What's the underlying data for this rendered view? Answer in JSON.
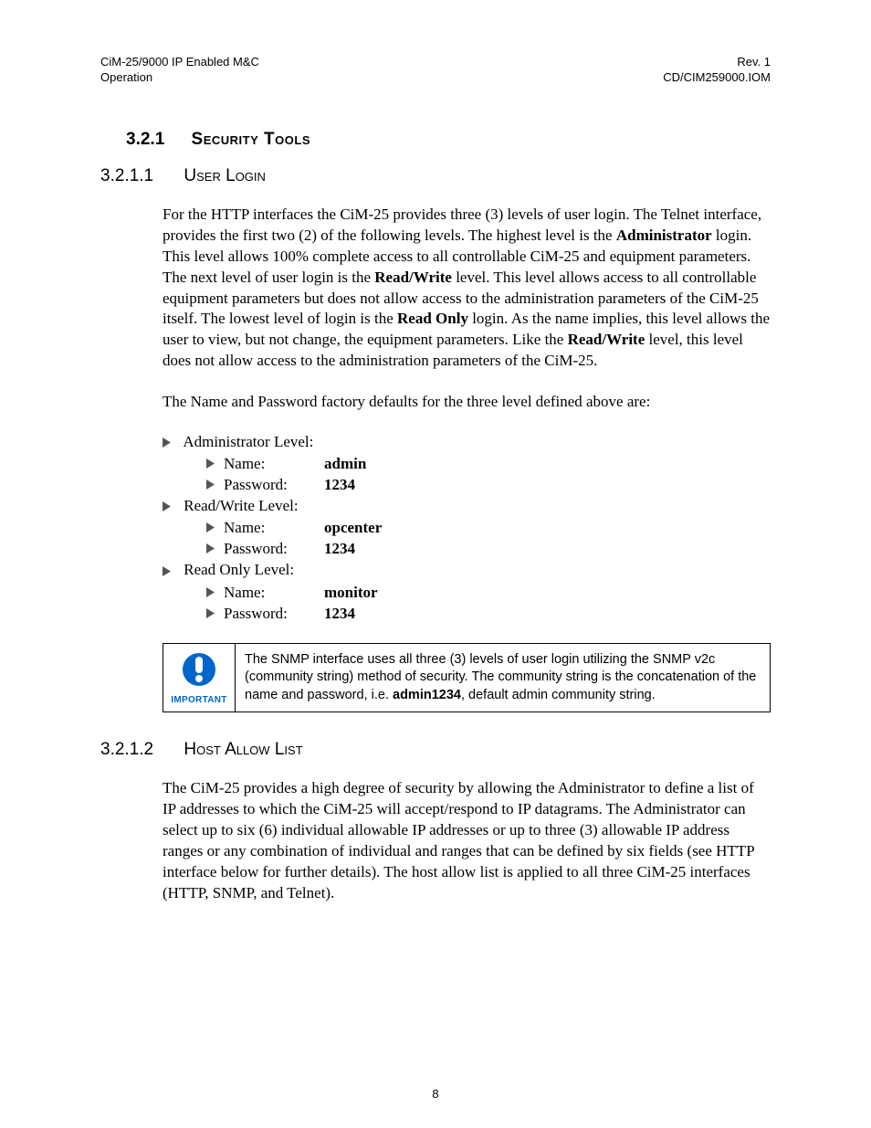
{
  "header": {
    "left_line1": "CiM-25/9000 IP Enabled M&C",
    "left_line2": "Operation",
    "right_line1": "Rev. 1",
    "right_line2": "CD/CIM259000.IOM"
  },
  "section_321": {
    "number": "3.2.1",
    "title": "Security Tools"
  },
  "section_3211": {
    "number": "3.2.1.1",
    "title": "User Login",
    "para1_a": "For the HTTP interfaces the CiM-25 provides three (3) levels of user login. The Telnet interface, provides the first two (2) of the following levels. The highest level is the ",
    "para1_b": "Administrator",
    "para1_c": " login.  This level allows 100% complete access to all controllable CiM-25 and equipment parameters.  The next level of user login is the ",
    "para1_d": "Read/Write",
    "para1_e": " level.  This level allows access to all controllable equipment parameters but does not allow access to the administration parameters of the CiM-25 itself.  The lowest level of login is the ",
    "para1_f": "Read Only",
    "para1_g": " login.  As the name implies, this level allows the user to view, but not change, the equipment parameters.  Like the ",
    "para1_h": "Read/Write",
    "para1_i": " level, this level does not allow access to the administration parameters of the CiM-25.",
    "para2": "The Name and Password factory defaults for the three level defined above are:",
    "levels": [
      {
        "label": "Administrator Level:",
        "name": "admin",
        "password": "1234"
      },
      {
        "label": "Read/Write Level:",
        "name": "opcenter",
        "password": "1234"
      },
      {
        "label": "Read Only Level:",
        "name": "monitor",
        "password": "1234"
      }
    ],
    "name_label": "Name:",
    "password_label": "Password:"
  },
  "note": {
    "icon_label": "IMPORTANT",
    "text_a": "The SNMP interface uses all three (3) levels of user login utilizing the SNMP v2c (community string) method of security.  The community string is the concatenation of the name and password, i.e. ",
    "text_b": "admin1234",
    "text_c": ", default admin community string."
  },
  "section_3212": {
    "number": "3.2.1.2",
    "title": "Host Allow List",
    "para": "The CiM-25 provides a high degree of security by allowing the Administrator to define a list of IP addresses to which the CiM-25 will accept/respond to IP datagrams.  The Administrator can select up to six (6) individual allowable IP addresses or up to three (3) allowable IP address ranges or any combination of individual and ranges that can be defined by six fields (see HTTP interface below for further details).  The host allow list is applied to all three CiM-25 interfaces (HTTP, SNMP, and Telnet)."
  },
  "page_number": "8"
}
